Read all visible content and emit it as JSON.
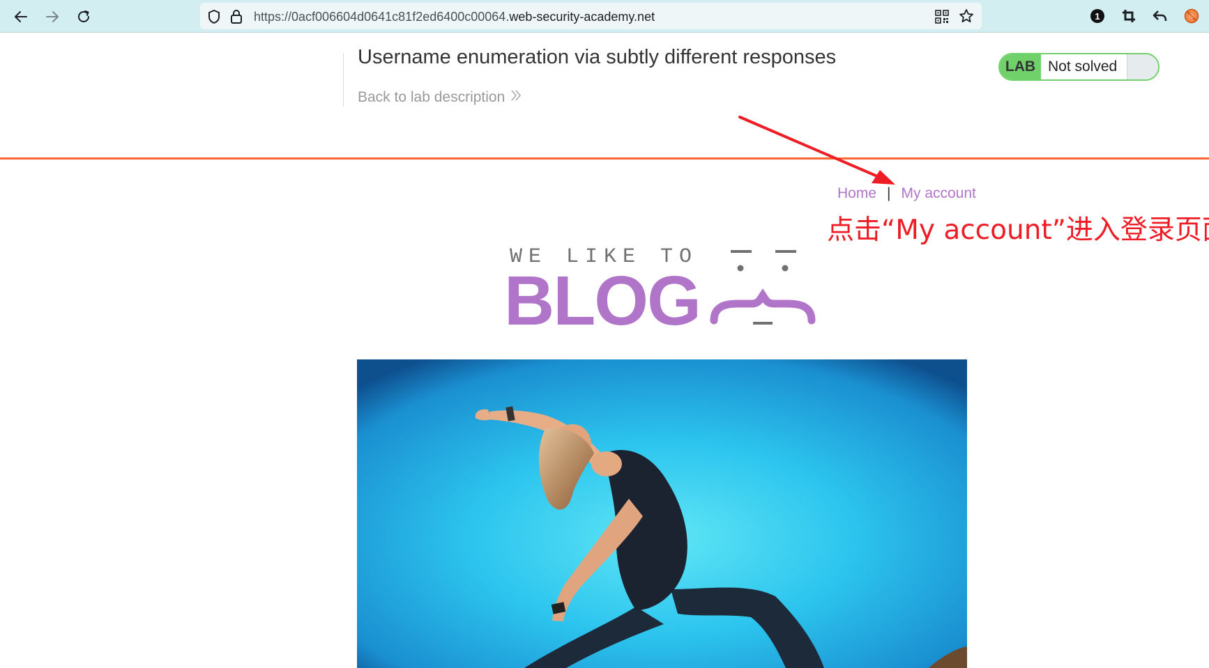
{
  "browser": {
    "url_prefix": "https://0acf006604d0641c81f2ed6400c00064.",
    "url_host": "web-security-academy.net",
    "icons": {
      "back": "back-arrow-icon",
      "forward": "forward-arrow-icon",
      "reload": "reload-icon",
      "shield": "shield-icon",
      "lock": "lock-icon",
      "qr": "qr-code-icon",
      "bookmark": "star-icon",
      "extension_badge": "1"
    }
  },
  "lab": {
    "title": "Username enumeration via subtly different responses",
    "back_link": "Back to lab description",
    "status_tag": "LAB",
    "status_text": "Not solved"
  },
  "blog_nav": {
    "home": "Home",
    "separator": "|",
    "account": "My account"
  },
  "annotation": {
    "text": "点击“My account”进入登录页面",
    "color": "#ee1c25"
  },
  "logo": {
    "top_text": "WE LIKE TO",
    "main_text": "BLOG"
  },
  "colors": {
    "accent": "#b074c8",
    "rule": "#ff6633",
    "lab_green": "#70d16a"
  }
}
